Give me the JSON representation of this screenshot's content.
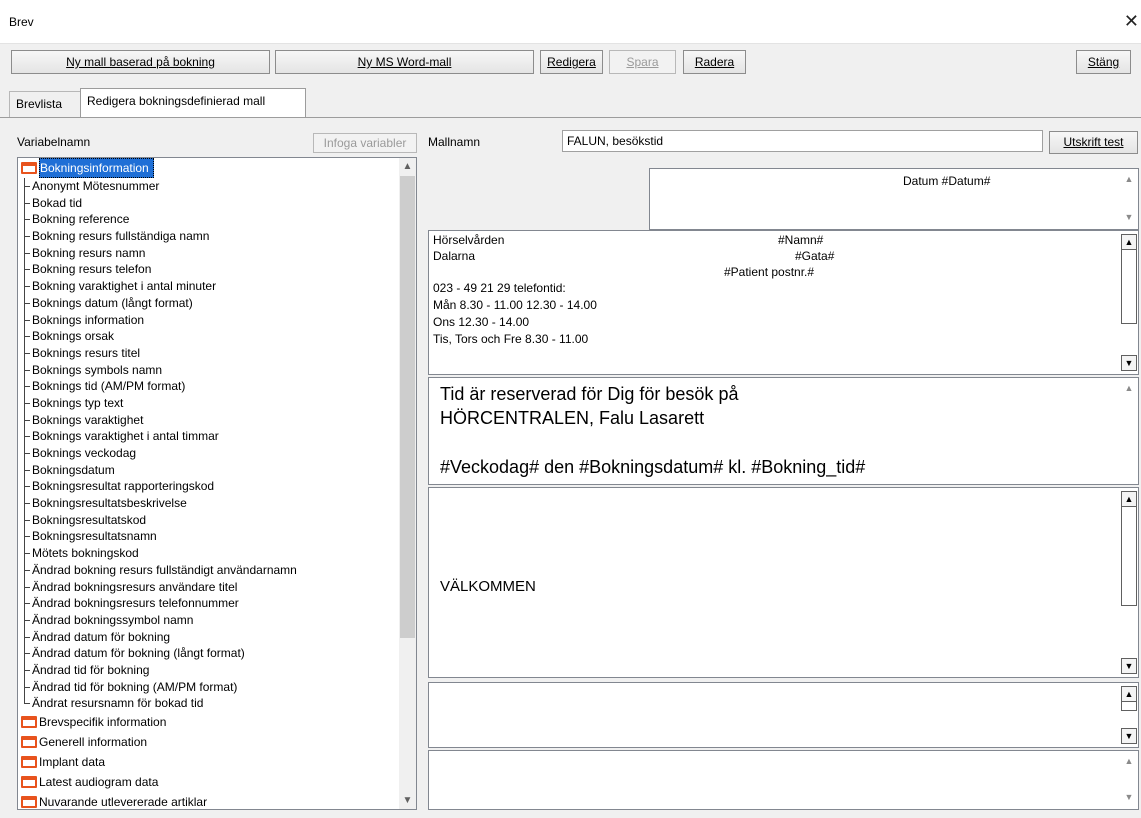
{
  "window": {
    "title": "Brev",
    "close_glyph": "✕"
  },
  "toolbar": {
    "new_template_booking": "Ny mall baserad på bokning",
    "new_word_template": "Ny MS Word-mall",
    "edit": "Redigera",
    "save": "Spara",
    "delete": "Radera",
    "close": "Stäng"
  },
  "tabs": [
    {
      "label": "Brevlista"
    },
    {
      "label": "Redigera bokningsdefinierad mall"
    }
  ],
  "variables": {
    "header": "Variabelnamn",
    "insert_button": "Infoga variabler",
    "group_open": "Bokningsinformation",
    "items": [
      "Anonymt Mötesnummer",
      "Bokad tid",
      "Bokning reference",
      "Bokning resurs fullständiga namn",
      "Bokning resurs namn",
      "Bokning resurs telefon",
      "Bokning varaktighet i antal minuter",
      "Boknings datum (långt format)",
      "Boknings information",
      "Boknings orsak",
      "Boknings resurs titel",
      "Boknings symbols namn",
      "Boknings tid (AM/PM format)",
      "Boknings typ text",
      "Boknings varaktighet",
      "Boknings varaktighet i antal timmar",
      "Boknings veckodag",
      "Bokningsdatum",
      "Bokningsresultat rapporteringskod",
      "Bokningsresultatsbeskrivelse",
      "Bokningsresultatskod",
      "Bokningsresultatsnamn",
      "Mötets bokningskod",
      "Ändrad bokning resurs fullständigt användarnamn",
      "Ändrad bokningsresurs användare titel",
      "Ändrad bokningsresurs telefonnummer",
      "Ändrad bokningssymbol namn",
      "Ändrad datum för bokning",
      "Ändrad datum för bokning (långt format)",
      "Ändrad tid för bokning",
      "Ändrad tid för bokning (AM/PM format)",
      "Ändrat resursnamn för bokad tid"
    ],
    "groups": [
      "Brevspecifik information",
      "Generell information",
      "Implant data",
      "Latest audiogram data",
      "Nuvarande utlevererade artiklar"
    ]
  },
  "template": {
    "name_label": "Mallnamn",
    "name_value": "FALUN, besökstid",
    "print_test": "Utskrift test",
    "header_text": "Datum #Datum#",
    "address": {
      "line1_left": "Hörselvården",
      "line1_right": "#Namn#",
      "line2_left": "Dalarna",
      "line2_right": "#Gata#",
      "line3_right": "#Patient postnr.#",
      "phone": "023 - 49 21 29 telefontid:",
      "hours1": "Mån  8.30 - 11.00  12.30 - 14.00",
      "hours2": "Ons  12.30 - 14.00",
      "hours3": "Tis, Tors och Fre  8.30 - 11.00"
    },
    "body_line1": "Tid är reserverad för Dig för besök på",
    "body_line2": "HÖRCENTRALEN, Falu Lasarett",
    "body_line3": "#Veckodag# den #Bokningsdatum# kl. #Bokning_tid#",
    "welcome": "VÄLKOMMEN"
  }
}
